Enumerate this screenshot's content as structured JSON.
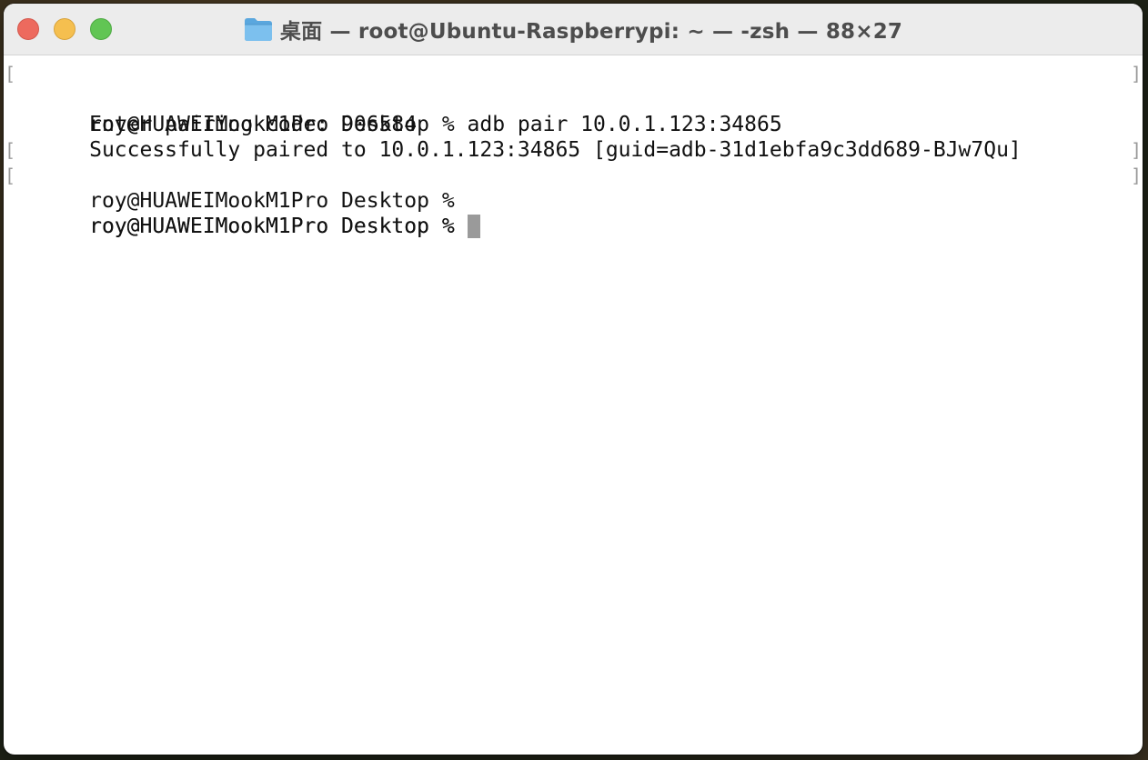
{
  "window": {
    "title": "桌面 — root@Ubuntu-Raspberrypi: ~ — -zsh — 88×27",
    "folder_icon": "folder-icon"
  },
  "traffic_lights": {
    "close_color": "#ed6a5e",
    "minimize_color": "#f5bf4f",
    "maximize_color": "#61c554"
  },
  "terminal": {
    "lines": [
      {
        "text": "roy@HUAWEIMookM1Pro Desktop % adb pair 10.0.1.123:34865",
        "marked": true
      },
      {
        "text": "Enter pairing code: 906584",
        "marked": false
      },
      {
        "text": "Successfully paired to 10.0.1.123:34865 [guid=adb-31d1ebfa9c3dd689-BJw7Qu]",
        "marked": false
      },
      {
        "text": "roy@HUAWEIMookM1Pro Desktop %",
        "marked": true
      },
      {
        "text": "roy@HUAWEIMookM1Pro Desktop %",
        "marked": true
      },
      {
        "text": "roy@HUAWEIMookM1Pro Desktop % ",
        "marked": false
      }
    ],
    "mark_left": "[",
    "mark_right": "]"
  }
}
